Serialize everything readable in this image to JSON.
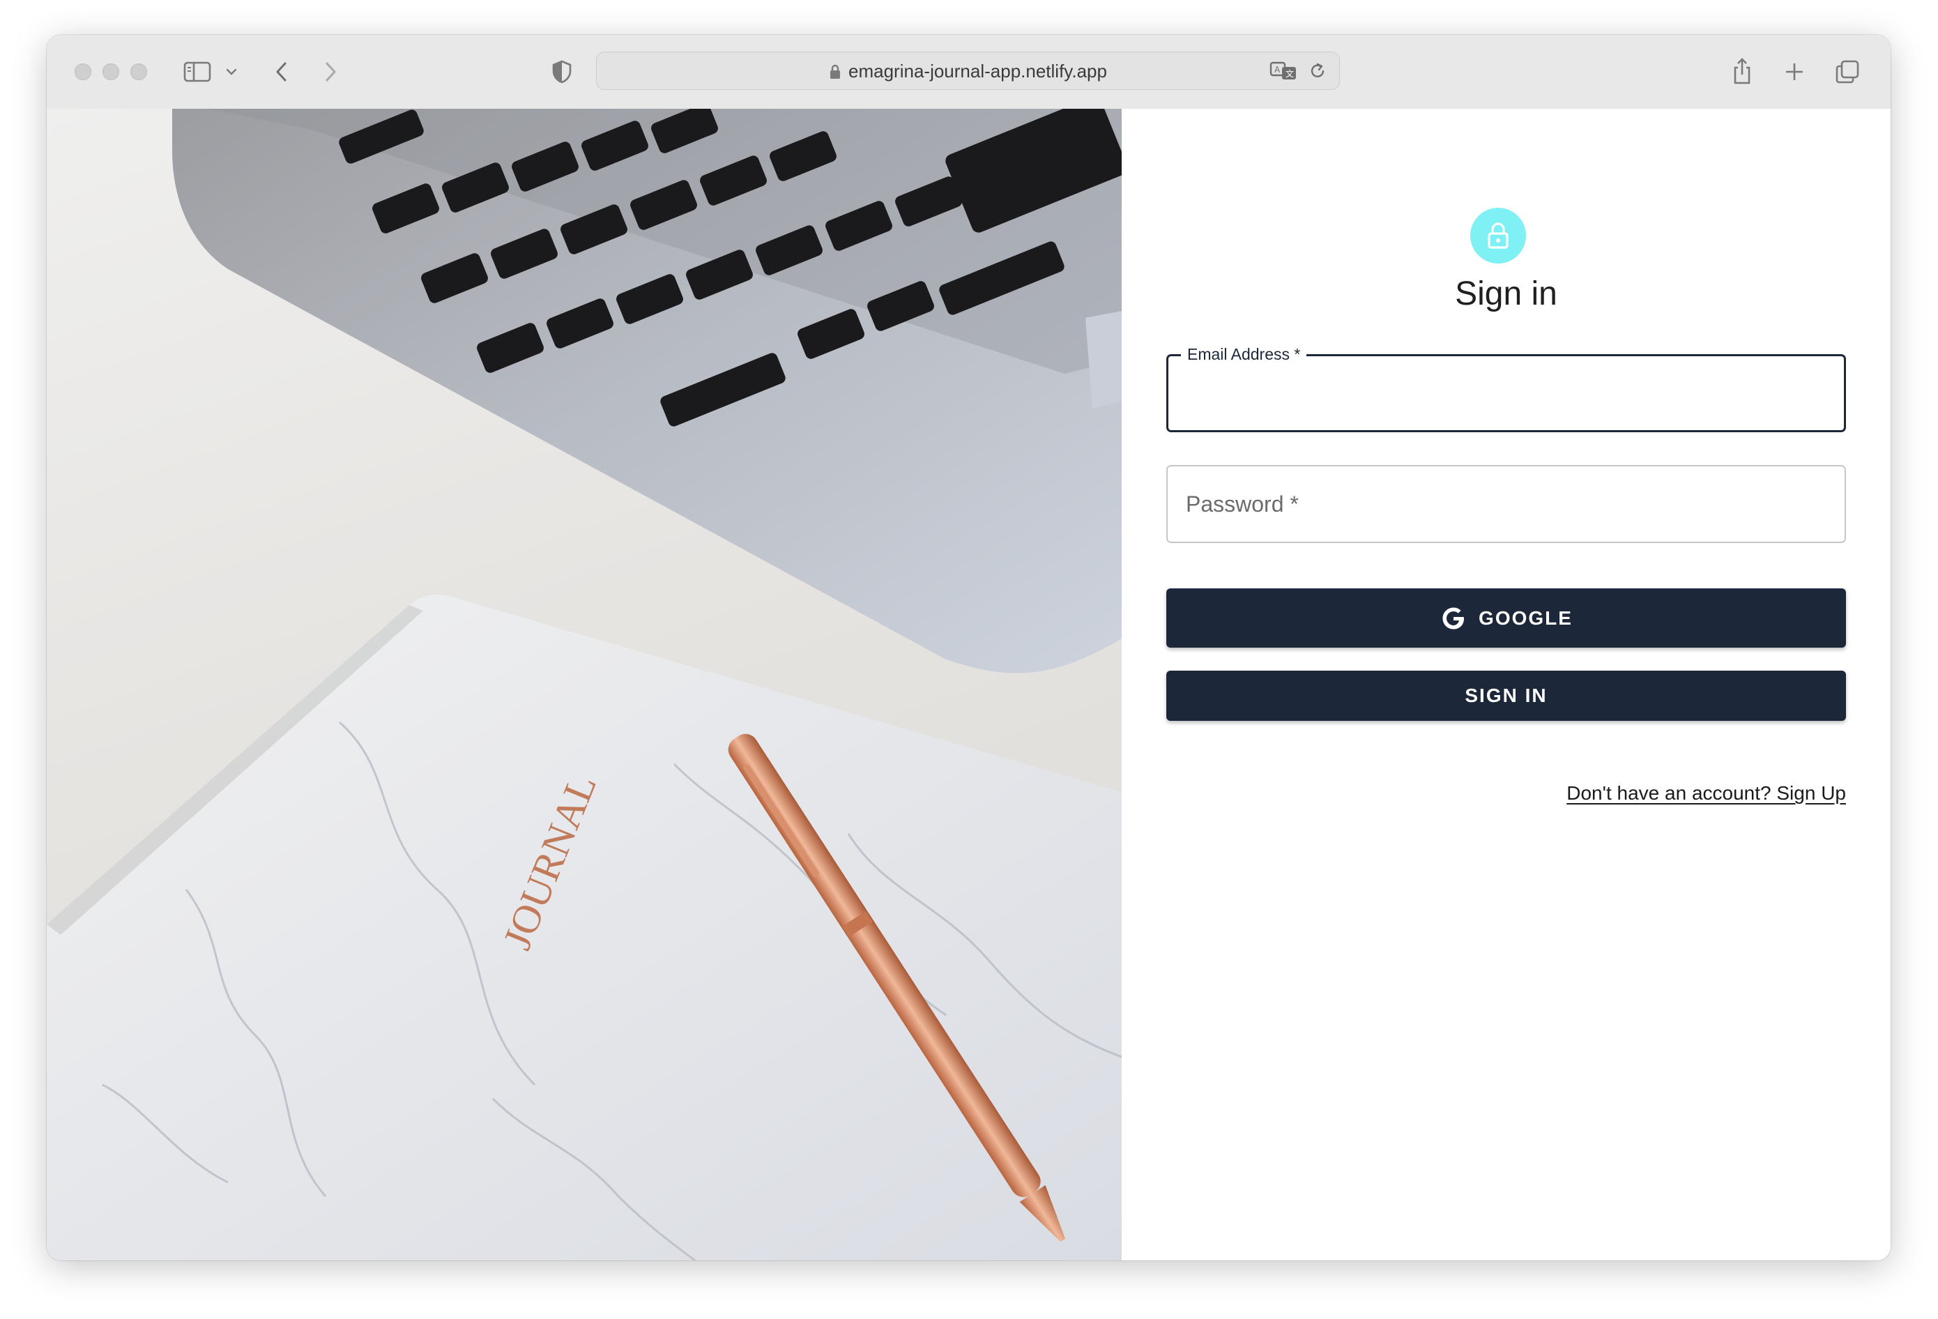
{
  "browser": {
    "url": "emagrina-journal-app.netlify.app",
    "icons": [
      "sidebar-icon",
      "chevron-down-icon",
      "back-icon",
      "forward-icon",
      "shield-icon",
      "lock-icon",
      "translate-icon",
      "reload-icon",
      "share-icon",
      "new-tab-icon",
      "tabs-overview-icon"
    ]
  },
  "hero": {
    "journal_text": "JOURNAL"
  },
  "signin": {
    "title": "Sign in",
    "avatar_icon": "lock-icon",
    "email_label": "Email Address *",
    "email_value": "",
    "password_label": "Password *",
    "google_label": "GOOGLE",
    "signin_label": "SIGN IN",
    "signup_link": "Don't have an account? Sign Up"
  },
  "colors": {
    "primary": "#1c273a",
    "avatar_bg": "#7ff0f3"
  }
}
